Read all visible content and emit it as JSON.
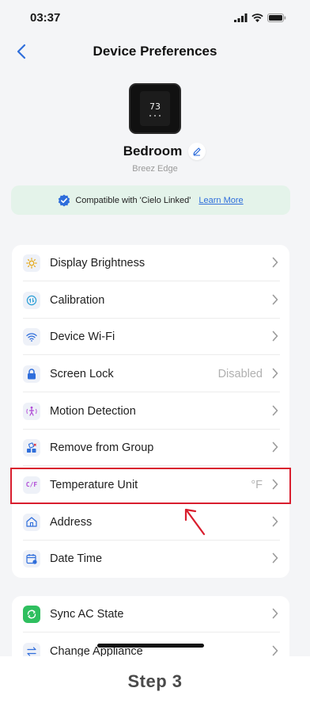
{
  "status_bar": {
    "time": "03:37",
    "icons": [
      "signal-icon",
      "wifi-icon",
      "battery-icon"
    ]
  },
  "nav": {
    "title": "Device Preferences",
    "back_icon": "chevron-left-icon"
  },
  "device": {
    "screen_temp": "73",
    "name": "Bedroom",
    "model": "Breez Edge",
    "edit_icon": "pencil-icon"
  },
  "compat": {
    "text": "Compatible with 'Cielo Linked'",
    "link": "Learn More",
    "icon": "verified-badge-icon"
  },
  "menu_main": [
    {
      "label": "Display Brightness",
      "value": "",
      "icon": "brightness-icon"
    },
    {
      "label": "Calibration",
      "value": "",
      "icon": "calibration-icon"
    },
    {
      "label": "Device Wi-Fi",
      "value": "",
      "icon": "wifi-icon"
    },
    {
      "label": "Screen Lock",
      "value": "Disabled",
      "icon": "lock-icon"
    },
    {
      "label": "Motion Detection",
      "value": "",
      "icon": "motion-icon"
    },
    {
      "label": "Remove from Group",
      "value": "",
      "icon": "remove-group-icon"
    },
    {
      "label": "Temperature Unit",
      "value": "°F",
      "icon": "cf-icon",
      "icon_text": "C/F"
    },
    {
      "label": "Address",
      "value": "",
      "icon": "address-icon"
    },
    {
      "label": "Date Time",
      "value": "",
      "icon": "calendar-icon"
    }
  ],
  "menu_second": [
    {
      "label": "Sync AC State",
      "icon": "sync-icon"
    },
    {
      "label": "Change Appliance",
      "icon": "swap-icon"
    }
  ],
  "caption": {
    "step": "Step 3"
  },
  "colors": {
    "accent": "#2f6edb",
    "highlight": "#d91e2e",
    "banner_bg": "#e4f3ea",
    "sync_green": "#2fbf5f"
  }
}
